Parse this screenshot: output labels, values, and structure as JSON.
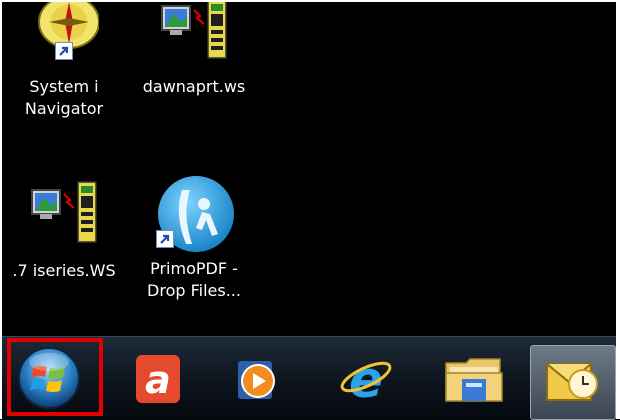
{
  "desktop": {
    "icons": [
      {
        "label": "System i\nNavigator",
        "icon": "system-i-navigator-icon"
      },
      {
        "label": "dawnaprt.ws",
        "icon": "workstation-session-icon"
      },
      {
        "label": ".7 iseries.WS",
        "icon": "workstation-session-icon"
      },
      {
        "label": "PrimoPDF -\nDrop Files...",
        "icon": "primopdf-icon"
      }
    ]
  },
  "taskbar": {
    "items": [
      {
        "name": "start-button",
        "icon": "windows-orb-icon",
        "highlighted": true
      },
      {
        "name": "app-a-button",
        "icon": "red-a-app-icon"
      },
      {
        "name": "media-player-button",
        "icon": "media-player-icon"
      },
      {
        "name": "internet-explorer-button",
        "icon": "internet-explorer-icon"
      },
      {
        "name": "file-explorer-button",
        "icon": "folder-icon"
      },
      {
        "name": "outlook-button",
        "icon": "outlook-icon",
        "active": true
      }
    ]
  },
  "colors": {
    "highlight": "#e00000",
    "desktop_bg": "#000000"
  }
}
